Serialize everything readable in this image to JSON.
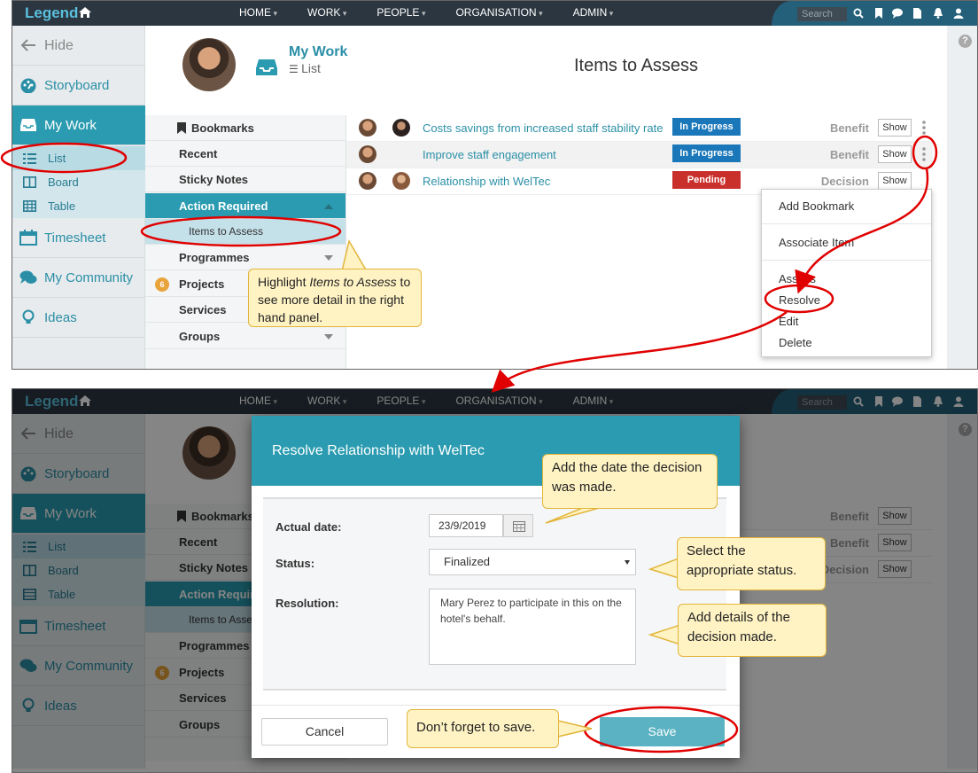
{
  "topbar": {
    "brand": "Legend",
    "menu": [
      "HOME",
      "WORK",
      "PEOPLE",
      "ORGANISATION",
      "ADMIN"
    ],
    "search_placeholder": "Search"
  },
  "sidebar": {
    "hide": "Hide",
    "items": [
      {
        "label": "Storyboard",
        "icon": "storyboard-icon"
      },
      {
        "label": "My Work",
        "icon": "inbox-icon"
      },
      {
        "label": "Timesheet",
        "icon": "calendar-icon"
      },
      {
        "label": "My Community",
        "icon": "chat-icon"
      },
      {
        "label": "Ideas",
        "icon": "lightbulb-icon"
      }
    ],
    "subitems": [
      "List",
      "Board",
      "Table"
    ]
  },
  "header": {
    "section_title": "My Work",
    "section_view": "List",
    "page_heading": "Items to Assess",
    "help": "?"
  },
  "midmenu": {
    "items": [
      "Bookmarks",
      "Recent",
      "Sticky Notes",
      "Action Required",
      "Items to Assess",
      "Programmes",
      "Projects",
      "Services",
      "Groups"
    ],
    "projects_badge": "6"
  },
  "rows": [
    {
      "title": "Costs savings from increased staff stability rate",
      "status": "In Progress",
      "kind": "Benefit",
      "button": "Show"
    },
    {
      "title": "Improve staff engagement",
      "status": "In Progress",
      "kind": "Benefit",
      "button": "Show"
    },
    {
      "title": "Relationship with WelTec",
      "status": "Pending",
      "kind": "Decision",
      "button": "Show"
    }
  ],
  "dropdown": [
    "Add Bookmark",
    "Associate Item",
    "Assess",
    "Resolve",
    "Edit",
    "Delete"
  ],
  "callouts": {
    "highlight_pre": "Highlight ",
    "highlight_em": "Items to Assess",
    "highlight_post": " to see more detail in the right hand panel.",
    "date": "Add the date the decision was made.",
    "status": "Select the appropriate status.",
    "details": "Add details of the decision made.",
    "save": "Don’t forget to save."
  },
  "modal": {
    "title": "Resolve Relationship with WelTec",
    "date_label": "Actual date:",
    "date_value": "23/9/2019",
    "status_label": "Status:",
    "status_value": "Finalized",
    "resolution_label": "Resolution:",
    "resolution_value": "Mary Perez to participate in this on the hotel's behalf.",
    "cancel": "Cancel",
    "save": "Save"
  },
  "colors": {
    "accent": "#2a9bb0",
    "link": "#2a8fa6",
    "in_progress": "#1a77b9",
    "pending": "#c9302c",
    "annotation": "#e00000",
    "callout_fill": "#fff3c4"
  }
}
